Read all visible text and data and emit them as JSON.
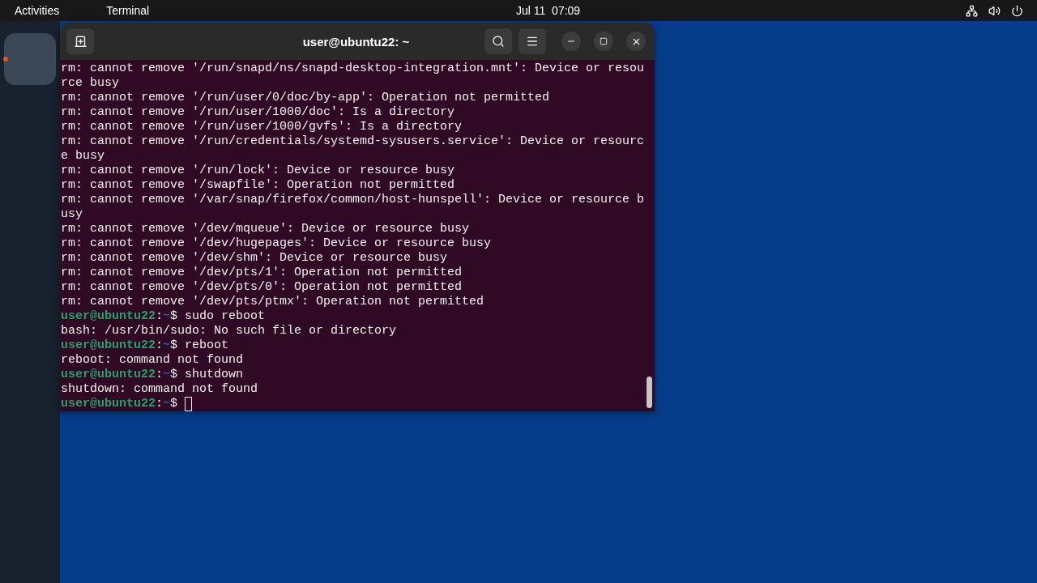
{
  "top_bar": {
    "activities": "Activities",
    "app_menu": "Terminal",
    "clock": "Jul 11  07:09"
  },
  "dock": {
    "apps": [
      {
        "running": true
      }
    ]
  },
  "terminal": {
    "title": "user@ubuntu22: ~",
    "lines": [
      {
        "kind": "output",
        "text": "rm: cannot remove '/run/snapd/ns/snapd-desktop-integration.mnt': Device or resource busy"
      },
      {
        "kind": "output",
        "text": "rm: cannot remove '/run/user/0/doc/by-app': Operation not permitted"
      },
      {
        "kind": "output",
        "text": "rm: cannot remove '/run/user/1000/doc': Is a directory"
      },
      {
        "kind": "output",
        "text": "rm: cannot remove '/run/user/1000/gvfs': Is a directory"
      },
      {
        "kind": "output",
        "text": "rm: cannot remove '/run/credentials/systemd-sysusers.service': Device or resource busy"
      },
      {
        "kind": "output",
        "text": "rm: cannot remove '/run/lock': Device or resource busy"
      },
      {
        "kind": "output",
        "text": "rm: cannot remove '/swapfile': Operation not permitted"
      },
      {
        "kind": "output",
        "text": "rm: cannot remove '/var/snap/firefox/common/host-hunspell': Device or resource busy"
      },
      {
        "kind": "output",
        "text": "rm: cannot remove '/dev/mqueue': Device or resource busy"
      },
      {
        "kind": "output",
        "text": "rm: cannot remove '/dev/hugepages': Device or resource busy"
      },
      {
        "kind": "output",
        "text": "rm: cannot remove '/dev/shm': Device or resource busy"
      },
      {
        "kind": "output",
        "text": "rm: cannot remove '/dev/pts/1': Operation not permitted"
      },
      {
        "kind": "output",
        "text": "rm: cannot remove '/dev/pts/0': Operation not permitted"
      },
      {
        "kind": "output",
        "text": "rm: cannot remove '/dev/pts/ptmx': Operation not permitted"
      },
      {
        "kind": "prompt",
        "user": "user@ubuntu22",
        "separator": ":",
        "path": "~",
        "symbol": "$",
        "command": "sudo reboot",
        "cursor": false
      },
      {
        "kind": "output",
        "text": "bash: /usr/bin/sudo: No such file or directory"
      },
      {
        "kind": "prompt",
        "user": "user@ubuntu22",
        "separator": ":",
        "path": "~",
        "symbol": "$",
        "command": "reboot",
        "cursor": false
      },
      {
        "kind": "output",
        "text": "reboot: command not found"
      },
      {
        "kind": "prompt",
        "user": "user@ubuntu22",
        "separator": ":",
        "path": "~",
        "symbol": "$",
        "command": "shutdown",
        "cursor": false
      },
      {
        "kind": "output",
        "text": "shutdown: command not found"
      },
      {
        "kind": "prompt",
        "user": "user@ubuntu22",
        "separator": ":",
        "path": "~",
        "symbol": "$",
        "cursor": true
      }
    ]
  }
}
